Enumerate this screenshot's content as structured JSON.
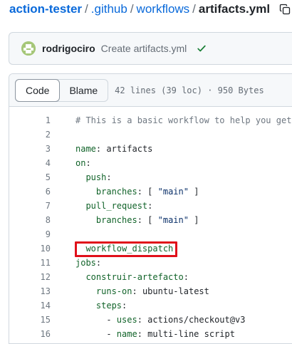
{
  "breadcrumb": {
    "repo": "action-tester",
    "sep": "/",
    "dir1": ".github",
    "dir2": "workflows",
    "file": "artifacts.yml"
  },
  "commit": {
    "author": "rodrigociro",
    "message": "Create artifacts.yml"
  },
  "file_header": {
    "tabs": [
      "Code",
      "Blame"
    ],
    "active_tab": "Code",
    "info": "42 lines (39 loc) · 950 Bytes"
  },
  "code_lines": [
    {
      "n": "1",
      "text": "# This is a basic workflow to help you get sta"
    },
    {
      "n": "2",
      "text": ""
    },
    {
      "n": "3",
      "text": "name: artifacts"
    },
    {
      "n": "4",
      "text": "on:"
    },
    {
      "n": "5",
      "text": "  push:"
    },
    {
      "n": "6",
      "text": "    branches: [ \"main\" ]"
    },
    {
      "n": "7",
      "text": "  pull_request:"
    },
    {
      "n": "8",
      "text": "    branches: [ \"main\" ]"
    },
    {
      "n": "9",
      "text": ""
    },
    {
      "n": "10",
      "text": "  workflow_dispatch:"
    },
    {
      "n": "11",
      "text": "jobs:"
    },
    {
      "n": "12",
      "text": "  construir-artefacto:"
    },
    {
      "n": "13",
      "text": "    runs-on: ubuntu-latest"
    },
    {
      "n": "14",
      "text": "    steps:"
    },
    {
      "n": "15",
      "text": "      - uses: actions/checkout@v3"
    },
    {
      "n": "16",
      "text": "      - name: multi-line script"
    }
  ],
  "highlighted_line": "10",
  "colors": {
    "link": "#0969da",
    "success": "#1a7f37",
    "highlight_border": "#e0101a"
  },
  "icons": {
    "copy": "copy-icon",
    "check": "check-icon",
    "avatar": "identicon-avatar"
  }
}
